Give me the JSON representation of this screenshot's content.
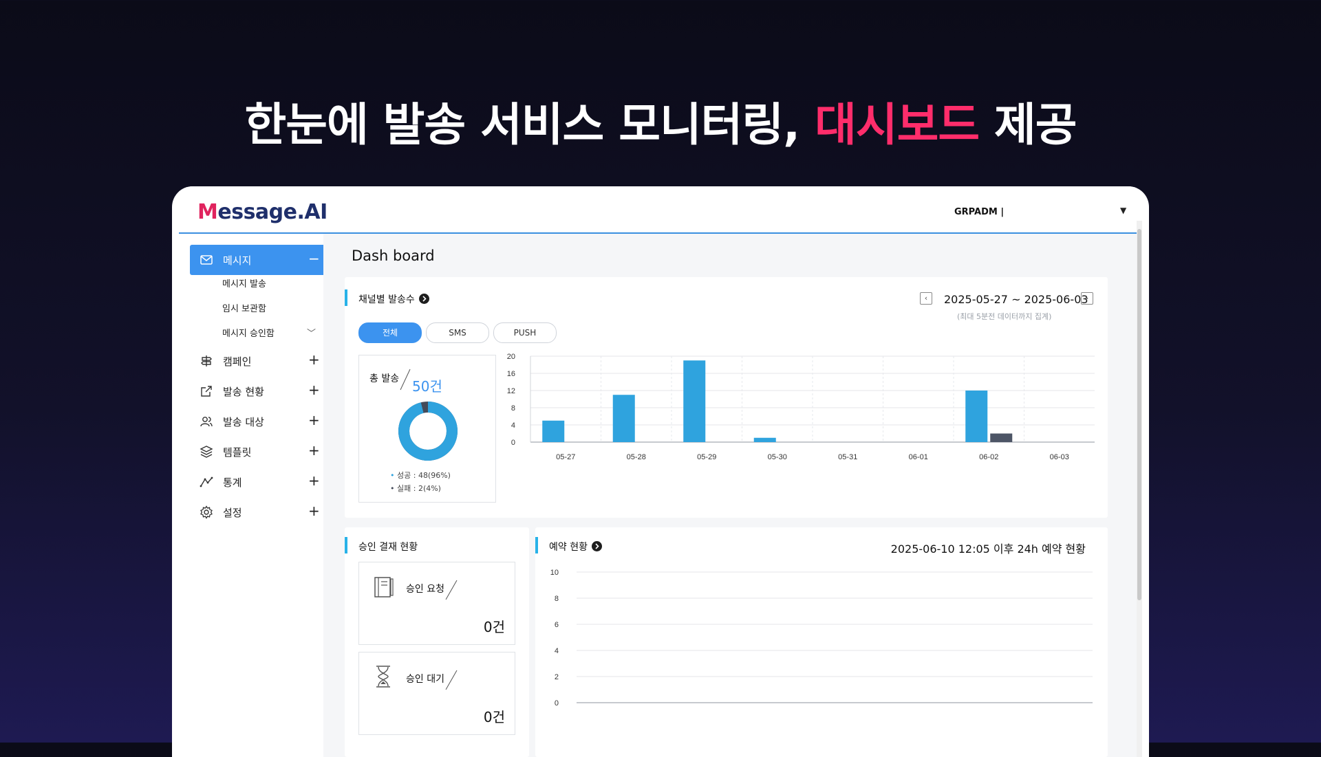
{
  "headline": {
    "part1": "한눈에 발송 서비스 모니터링, ",
    "accent": "대시보드",
    "part2": " 제공"
  },
  "app": {
    "logo_first": "M",
    "logo_rest": "essage.AI",
    "user": "GRPADM |"
  },
  "colors": {
    "primary": "#3c93ef",
    "accent": "#ff2d6b",
    "success_bar": "#2fa3de",
    "fail_bar": "#4d5566",
    "donut_fail": "#444b5a"
  },
  "sidebar": {
    "items": [
      {
        "label": "메시지",
        "icon": "mail-icon",
        "sign": "−",
        "active": true
      },
      {
        "label": "캠페인",
        "icon": "signpost-icon",
        "sign": "+"
      },
      {
        "label": "발송 현황",
        "icon": "external-link-icon",
        "sign": "+"
      },
      {
        "label": "발송 대상",
        "icon": "users-icon",
        "sign": "+"
      },
      {
        "label": "템플릿",
        "icon": "layers-icon",
        "sign": "+"
      },
      {
        "label": "통계",
        "icon": "trend-icon",
        "sign": "+"
      },
      {
        "label": "설정",
        "icon": "gear-icon",
        "sign": "+"
      }
    ],
    "sub_items": [
      "메시지 발송",
      "임시 보관함",
      "메시지 승인함"
    ]
  },
  "main": {
    "page_title": "Dash board",
    "channel_card": {
      "title": "채널별 발송수",
      "date_range": "2025-05-27 ~ 2025-06-03",
      "date_note": "(최대 5분전 데이터까지 집계)",
      "tabs": [
        "전체",
        "SMS",
        "PUSH"
      ],
      "total_label": "총 발송",
      "total_value": "50건",
      "success_label": "성공 : 48(96%)",
      "fail_label": "실패 : 2(4%)",
      "success_ratio": 0.96
    },
    "approval_card": {
      "title": "승인 결재 현황",
      "request_label": "승인 요청",
      "request_value": "0건",
      "pending_label": "승인 대기",
      "pending_value": "0건"
    },
    "reservation_card": {
      "title": "예약 현황",
      "subtitle": "2025-06-10 12:05 이후 24h 예약 현황"
    }
  },
  "chart_data": [
    {
      "type": "bar",
      "categories": [
        "05-27",
        "05-28",
        "05-29",
        "05-30",
        "05-31",
        "06-01",
        "06-02",
        "06-03"
      ],
      "series": [
        {
          "values": [
            5,
            11,
            19,
            1,
            0,
            0,
            12,
            0
          ]
        },
        {
          "values": [
            0,
            0,
            0,
            0,
            0,
            0,
            2,
            0
          ]
        }
      ],
      "yticks": [
        0,
        4,
        8,
        12,
        16,
        20
      ],
      "ylim": [
        0,
        20
      ],
      "grid": true
    },
    {
      "type": "bar",
      "categories": [],
      "series": [],
      "yticks": [
        0,
        2,
        4,
        6,
        8,
        10
      ],
      "ylim": [
        0,
        10
      ],
      "grid": true
    }
  ]
}
